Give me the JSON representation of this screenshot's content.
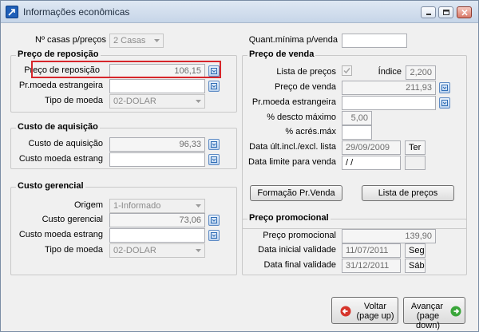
{
  "window": {
    "title": "Informações econômicas"
  },
  "top": {
    "num_casas_label": "Nº casas p/preços",
    "num_casas_value": "2 Casas",
    "quant_minima_label": "Quant.mínima p/venda",
    "quant_minima_value": ""
  },
  "reposicao": {
    "title": "Preço de reposição",
    "preco_label": "Preço de reposição",
    "preco_value": "106,15",
    "pr_moeda_label": "Pr.moeda estrangeira",
    "pr_moeda_value": "",
    "tipo_moeda_label": "Tipo de moeda",
    "tipo_moeda_value": "02-DOLAR"
  },
  "aquisicao": {
    "title": "Custo de aquisição",
    "custo_label": "Custo de aquisição",
    "custo_value": "96,33",
    "moeda_label": "Custo moeda estrang",
    "moeda_value": ""
  },
  "gerencial": {
    "title": "Custo gerencial",
    "origem_label": "Origem",
    "origem_value": "1-Informado",
    "custo_label": "Custo gerencial",
    "custo_value": "73,06",
    "moeda_label": "Custo moeda estrang",
    "moeda_value": "",
    "tipo_moeda_label": "Tipo de moeda",
    "tipo_moeda_value": "02-DOLAR"
  },
  "venda": {
    "title": "Preço de venda",
    "lista_label": "Lista de preços",
    "indice_label": "Índice",
    "indice_value": "2,200",
    "preco_label": "Preço de venda",
    "preco_value": "211,93",
    "pr_moeda_label": "Pr.moeda estrangeira",
    "pr_moeda_value": "",
    "desconto_label": "% descto máximo",
    "desconto_value": "5,00",
    "acres_label": "% acrés.máx",
    "acres_value": "",
    "data_ult_label": "Data últ.incl./excl. lista",
    "data_ult_value": "29/09/2009",
    "data_ult_day": "Ter",
    "data_limite_label": "Data limite para venda",
    "data_limite_value": "/  /",
    "data_limite_day": "",
    "formacao_button": "Formação Pr.Venda",
    "lista_button": "Lista de preços"
  },
  "promocional": {
    "title": "Preço promocional",
    "preco_label": "Preço promocional",
    "preco_value": "139,90",
    "inicial_label": "Data inicial validade",
    "inicial_value": "11/07/2011",
    "inicial_day": "Seg",
    "final_label": "Data final validade",
    "final_value": "31/12/2011",
    "final_day": "Sáb"
  },
  "footer": {
    "voltar_line1": "Voltar",
    "voltar_line2": "(page up)",
    "avancar_line1": "Avançar",
    "avancar_line2": "(page down)"
  },
  "colors": {
    "highlight": "#d6262b",
    "back_arrow": "#d6352b",
    "forward_arrow": "#3aa63a"
  }
}
